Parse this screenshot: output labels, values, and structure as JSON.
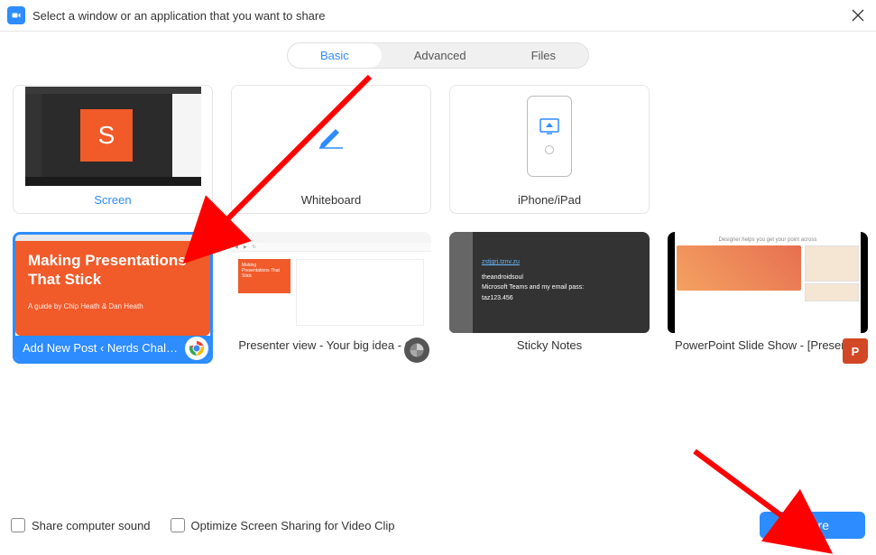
{
  "header": {
    "title": "Select a window or an application that you want to share"
  },
  "tabs": [
    {
      "label": "Basic",
      "active": true
    },
    {
      "label": "Advanced",
      "active": false
    },
    {
      "label": "Files",
      "active": false
    }
  ],
  "row1": [
    {
      "label": "Screen"
    },
    {
      "label": "Whiteboard"
    },
    {
      "label": "iPhone/iPad"
    }
  ],
  "row2": [
    {
      "label": "Add New Post ‹ Nerds Chalk — ...",
      "selected": true,
      "app": "chrome"
    },
    {
      "label": "Presenter view - Your big idea - G...",
      "app": "generic"
    },
    {
      "label": "Sticky Notes",
      "app": "none"
    },
    {
      "label": "PowerPoint Slide Show - [Present...",
      "app": "powerpoint"
    }
  ],
  "preview_content": {
    "chrome_slide_title": "Making Presentations That Stick",
    "chrome_slide_sub": "A guide by Chip Heath & Dan Heath",
    "sticky_link": "zstjgrj.tznv.zu",
    "sticky_line1": "theandroidsoul",
    "sticky_line2": "Microsoft Teams and my email pass:",
    "sticky_line3": "taz123.456",
    "ppt_header": "Designer helps you get your point across"
  },
  "footer": {
    "checkbox1": "Share computer sound",
    "checkbox2": "Optimize Screen Sharing for Video Clip",
    "share_button": "Share"
  }
}
